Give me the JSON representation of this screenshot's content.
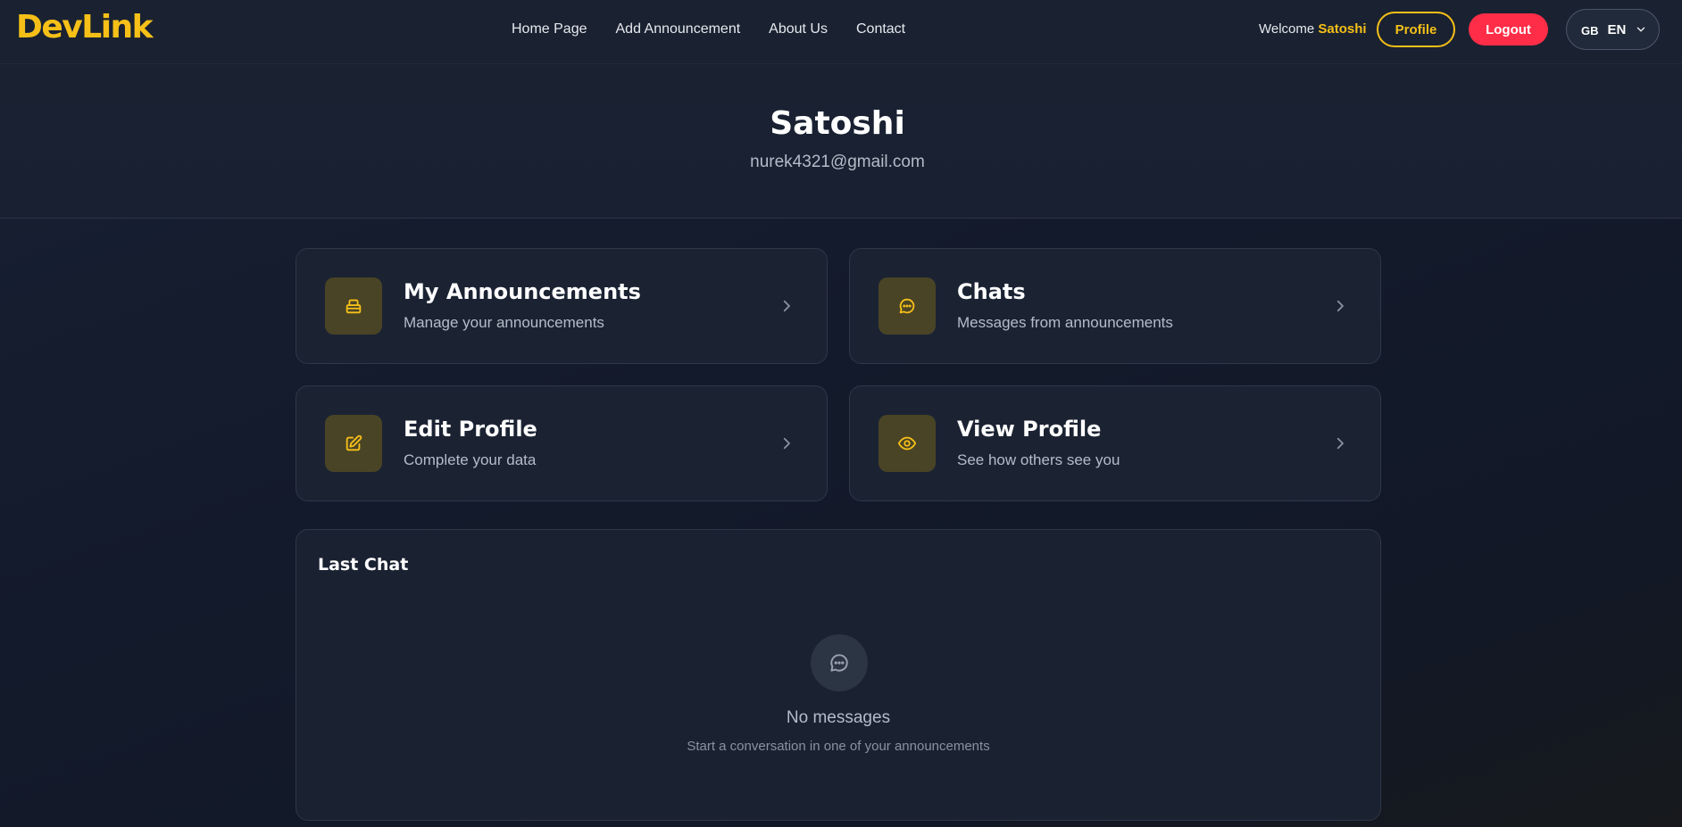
{
  "brand": {
    "name": "DevLink",
    "accent": "#f6c018",
    "danger": "#ff2d47"
  },
  "nav": {
    "links": [
      "Home Page",
      "Add Announcement",
      "About Us",
      "Contact"
    ],
    "welcome_prefix": "Welcome",
    "username": "Satoshi",
    "profile_button": "Profile",
    "logout_button": "Logout",
    "language": {
      "flag": "GB",
      "code": "EN",
      "icon": "chevron-down-icon"
    }
  },
  "profile": {
    "name": "Satoshi",
    "email": "nurek4321@gmail.com"
  },
  "cards": [
    {
      "title": "My Announcements",
      "subtitle": "Manage your announcements",
      "icon": "inbox-icon"
    },
    {
      "title": "Chats",
      "subtitle": "Messages from announcements",
      "icon": "chat-bubble-icon"
    },
    {
      "title": "Edit Profile",
      "subtitle": "Complete your data",
      "icon": "edit-icon"
    },
    {
      "title": "View Profile",
      "subtitle": "See how others see you",
      "icon": "eye-icon"
    }
  ],
  "last_chat": {
    "title": "Last Chat",
    "empty_title": "No messages",
    "empty_subtitle": "Start a conversation in one of your announcements",
    "icon": "chat-bubble-icon"
  }
}
